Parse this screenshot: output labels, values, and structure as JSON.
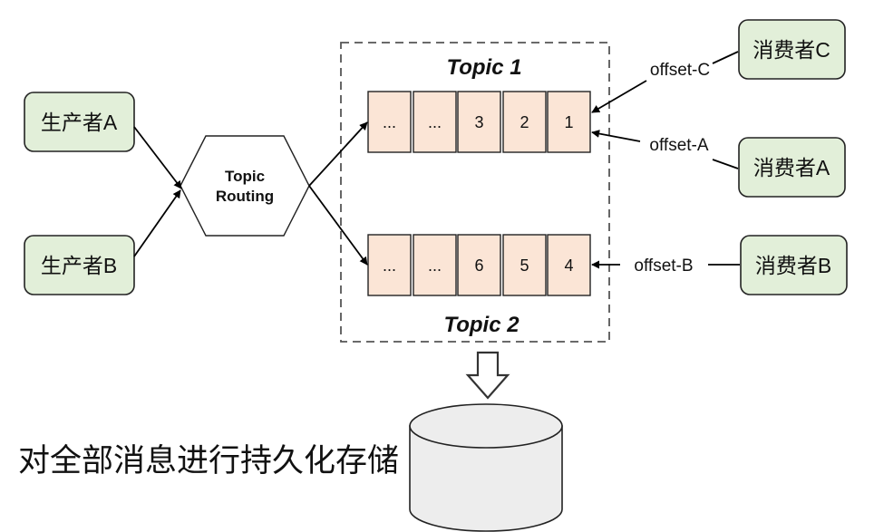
{
  "producers": {
    "a": "生产者A",
    "b": "生产者B"
  },
  "router": {
    "line1": "Topic",
    "line2": "Routing"
  },
  "topics": {
    "topic1": {
      "label": "Topic 1",
      "cells": [
        "...",
        "...",
        "3",
        "2",
        "1"
      ]
    },
    "topic2": {
      "label": "Topic 2",
      "cells": [
        "...",
        "...",
        "6",
        "5",
        "4"
      ]
    }
  },
  "consumers": {
    "c": "消费者C",
    "a": "消费者A",
    "b": "消费者B"
  },
  "offsets": {
    "c": "offset-C",
    "a": "offset-A",
    "b": "offset-B"
  },
  "storage": {
    "caption": "对全部消息进行持久化存储"
  }
}
